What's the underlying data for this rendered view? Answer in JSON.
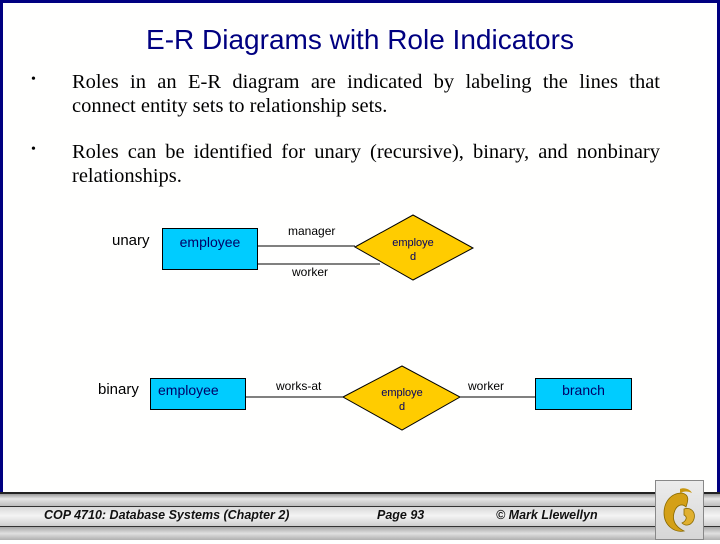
{
  "title": "E-R Diagrams with Role Indicators",
  "bullets": [
    {
      "marker": "•",
      "text": "Roles in an E-R diagram are indicated by labeling the lines that connect entity sets to relationship sets."
    },
    {
      "marker": "•",
      "text": "Roles can be identified for unary (recursive), binary, and nonbinary relationships."
    }
  ],
  "diagrams": {
    "unary": {
      "label": "unary",
      "entity": "employee",
      "relationship": [
        "employe",
        "d"
      ],
      "roles": {
        "top": "manager",
        "bottom": "worker"
      }
    },
    "binary": {
      "label": "binary",
      "entity_left": "employee",
      "relationship": [
        "employe",
        "d"
      ],
      "entity_right": "branch",
      "roles": {
        "left": "works-at",
        "right": "worker"
      }
    }
  },
  "colors": {
    "border": "#000080",
    "title": "#000080",
    "entity_fill": "#00ccff",
    "relationship_fill": "#ffcc00"
  },
  "footer": {
    "course": "COP 4710: Database Systems  (Chapter 2)",
    "page": "Page 93",
    "author": "© Mark Llewellyn",
    "logo_icon": "ucf-pegasus-logo-icon"
  }
}
